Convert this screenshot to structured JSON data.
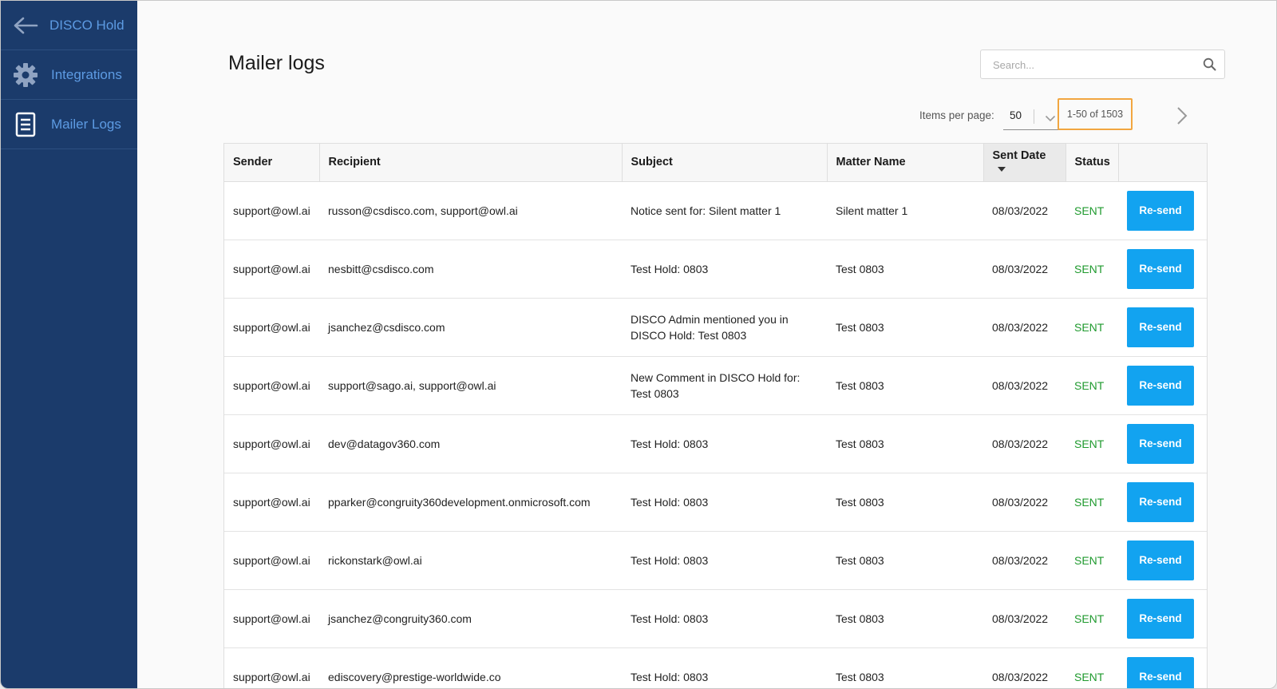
{
  "sidebar": {
    "items": [
      {
        "label": "DISCO Hold",
        "icon": "arrow-left-icon"
      },
      {
        "label": "Integrations",
        "icon": "gear-icon"
      },
      {
        "label": "Mailer Logs",
        "icon": "document-list-icon"
      }
    ]
  },
  "header": {
    "title": "Mailer logs",
    "search_placeholder": "Search...",
    "search_icon": "search-icon"
  },
  "pagination": {
    "items_per_page_label": "Items per page:",
    "items_per_page_value": "50",
    "range_label": "1-50 of 1503",
    "next_icon": "chevron-right-icon"
  },
  "colors": {
    "sidebar_bg": "#1b3b6b",
    "sidebar_text": "#5d9be3",
    "status_sent": "#1f9a2e",
    "resend_button": "#12a3f0",
    "range_highlight": "#f2a640"
  },
  "table": {
    "columns": [
      "Sender",
      "Recipient",
      "Subject",
      "Matter Name",
      "Sent Date",
      "Status",
      ""
    ],
    "sorted_column": "Sent Date",
    "action_label": "Re-send",
    "rows": [
      {
        "sender": "support@owl.ai",
        "recipient": "russon@csdisco.com, support@owl.ai",
        "subject": "Notice sent for: Silent matter 1",
        "matter": "Silent matter 1",
        "date": "08/03/2022",
        "status": "SENT"
      },
      {
        "sender": "support@owl.ai",
        "recipient": "nesbitt@csdisco.com",
        "subject": "Test Hold: 0803",
        "matter": "Test 0803",
        "date": "08/03/2022",
        "status": "SENT"
      },
      {
        "sender": "support@owl.ai",
        "recipient": "jsanchez@csdisco.com",
        "subject": "DISCO Admin mentioned you in DISCO Hold: Test 0803",
        "matter": "Test 0803",
        "date": "08/03/2022",
        "status": "SENT"
      },
      {
        "sender": "support@owl.ai",
        "recipient": "support@sago.ai, support@owl.ai",
        "subject": "New Comment in DISCO Hold for: Test 0803",
        "matter": "Test 0803",
        "date": "08/03/2022",
        "status": "SENT"
      },
      {
        "sender": "support@owl.ai",
        "recipient": "dev@datagov360.com",
        "subject": "Test Hold: 0803",
        "matter": "Test 0803",
        "date": "08/03/2022",
        "status": "SENT"
      },
      {
        "sender": "support@owl.ai",
        "recipient": "pparker@congruity360development.onmicrosoft.com",
        "subject": "Test Hold: 0803",
        "matter": "Test 0803",
        "date": "08/03/2022",
        "status": "SENT"
      },
      {
        "sender": "support@owl.ai",
        "recipient": "rickonstark@owl.ai",
        "subject": "Test Hold: 0803",
        "matter": "Test 0803",
        "date": "08/03/2022",
        "status": "SENT"
      },
      {
        "sender": "support@owl.ai",
        "recipient": "jsanchez@congruity360.com",
        "subject": "Test Hold: 0803",
        "matter": "Test 0803",
        "date": "08/03/2022",
        "status": "SENT"
      },
      {
        "sender": "support@owl.ai",
        "recipient": "ediscovery@prestige-worldwide.co",
        "subject": "Test Hold: 0803",
        "matter": "Test 0803",
        "date": "08/03/2022",
        "status": "SENT"
      }
    ]
  }
}
